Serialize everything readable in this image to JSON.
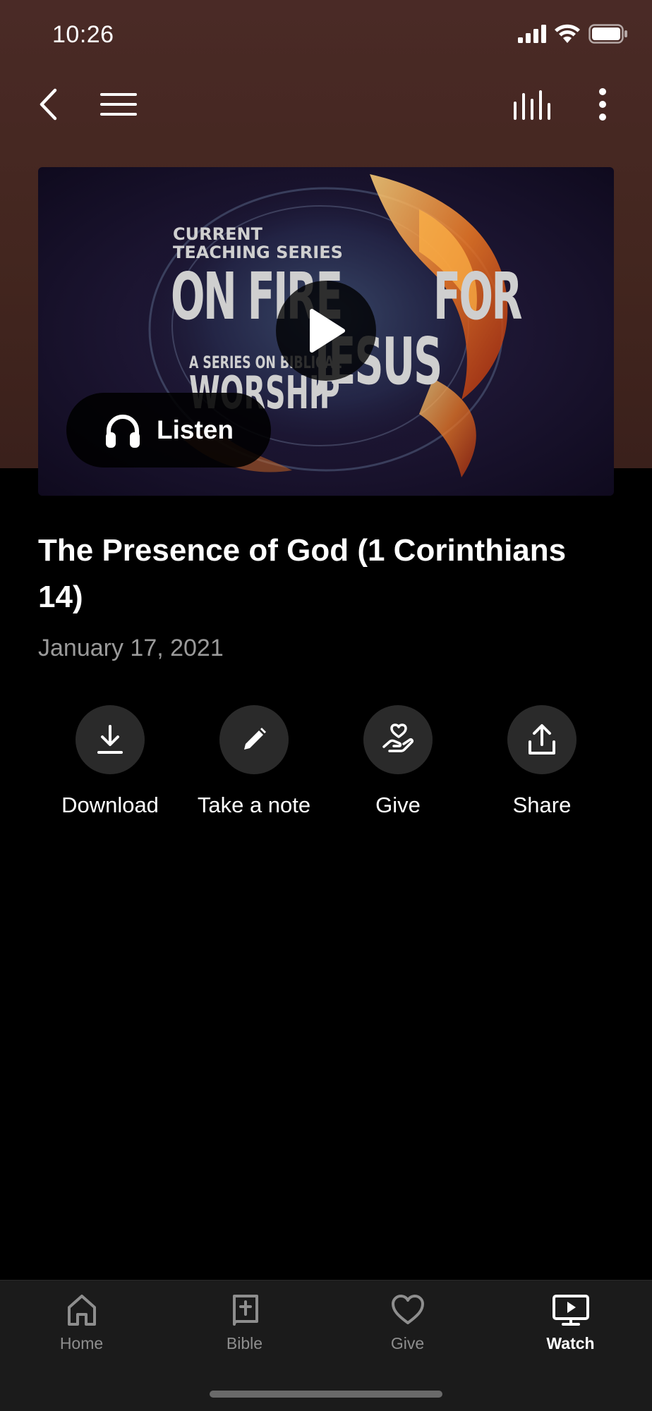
{
  "status_bar": {
    "time": "10:26"
  },
  "hero": {
    "artwork_text": {
      "line1": "CURRENT",
      "line2": "TEACHING SERIES",
      "big1": "ON FIRE",
      "big2": "FOR",
      "small": "A SERIES ON BIBLICAL",
      "big3": "WORSHIP",
      "big4": "JESUS"
    },
    "listen_label": "Listen"
  },
  "sermon": {
    "title": "The Presence of God (1 Corinthians 14)",
    "date": "January 17, 2021"
  },
  "actions": [
    {
      "label": "Download",
      "icon": "download-icon"
    },
    {
      "label": "Take a note",
      "icon": "pencil-icon"
    },
    {
      "label": "Give",
      "icon": "give-heart-hand-icon"
    },
    {
      "label": "Share",
      "icon": "share-icon"
    }
  ],
  "tabs": [
    {
      "label": "Home",
      "icon": "home-icon",
      "active": false
    },
    {
      "label": "Bible",
      "icon": "bible-icon",
      "active": false
    },
    {
      "label": "Give",
      "icon": "heart-icon",
      "active": false
    },
    {
      "label": "Watch",
      "icon": "tv-play-icon",
      "active": true
    }
  ],
  "colors": {
    "header_bg": "#43261f",
    "background": "#000000",
    "tabbar_bg": "#1b1b1b",
    "inactive_tab": "#8e8e8e"
  }
}
